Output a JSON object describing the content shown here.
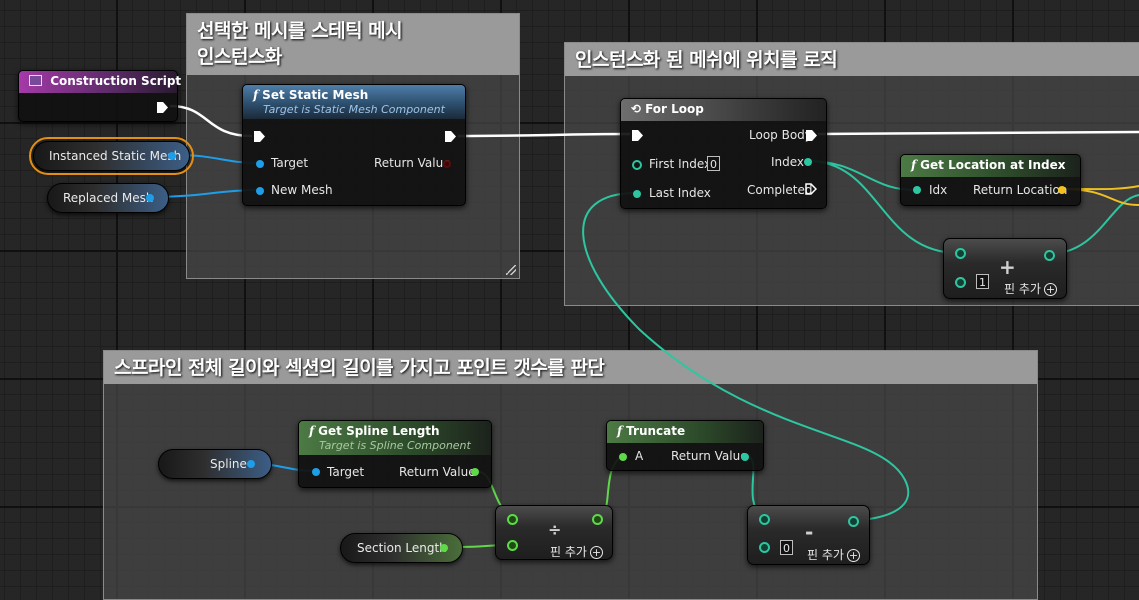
{
  "comments": [
    {
      "title_line1": "선택한 메시를 스테틱 메시",
      "title_line2": "인스턴스화"
    },
    {
      "title": "인스턴스화 된 메쉬에 위치를 로직"
    },
    {
      "title": "스프라인 전체 길이와 섹션의 길이를 가지고 포인트 갯수를 판단"
    }
  ],
  "construction_script": {
    "title": "Construction Script"
  },
  "variables": {
    "instanced_static_mesh": "Instanced Static Mesh",
    "replaced_mesh": "Replaced Mesh",
    "spline": "Spline",
    "section_length": "Section Length"
  },
  "set_static_mesh": {
    "title": "Set Static Mesh",
    "subtitle": "Target is Static Mesh Component",
    "target": "Target",
    "new_mesh": "New Mesh",
    "return_value": "Return Value"
  },
  "for_loop": {
    "title": "For Loop",
    "first_index": "First Index",
    "first_index_value": "0",
    "last_index": "Last Index",
    "loop_body": "Loop Body",
    "index": "Index",
    "completed": "Completed"
  },
  "get_location_at_index": {
    "title": "Get Location at Index",
    "idx": "Idx",
    "return_location": "Return Location"
  },
  "add_node": {
    "operator": "+",
    "value": "1",
    "add_pin": "핀 추가"
  },
  "get_spline_length": {
    "title": "Get Spline Length",
    "subtitle": "Target is Spline Component",
    "target": "Target",
    "return_value": "Return Value"
  },
  "truncate": {
    "title": "Truncate",
    "a": "A",
    "return_value": "Return Value"
  },
  "divide_node": {
    "operator": "÷",
    "add_pin": "핀 추가"
  },
  "subtract_node": {
    "operator": "-",
    "value": "0",
    "add_pin": "핀 추가"
  },
  "colors": {
    "exec_wire": "#ffffff",
    "object_wire": "#1e9ee8",
    "int_wire": "#2cc6a0",
    "float_wire": "#5fd84a",
    "vector_wire": "#f0c020",
    "selection": "#e38f14"
  }
}
